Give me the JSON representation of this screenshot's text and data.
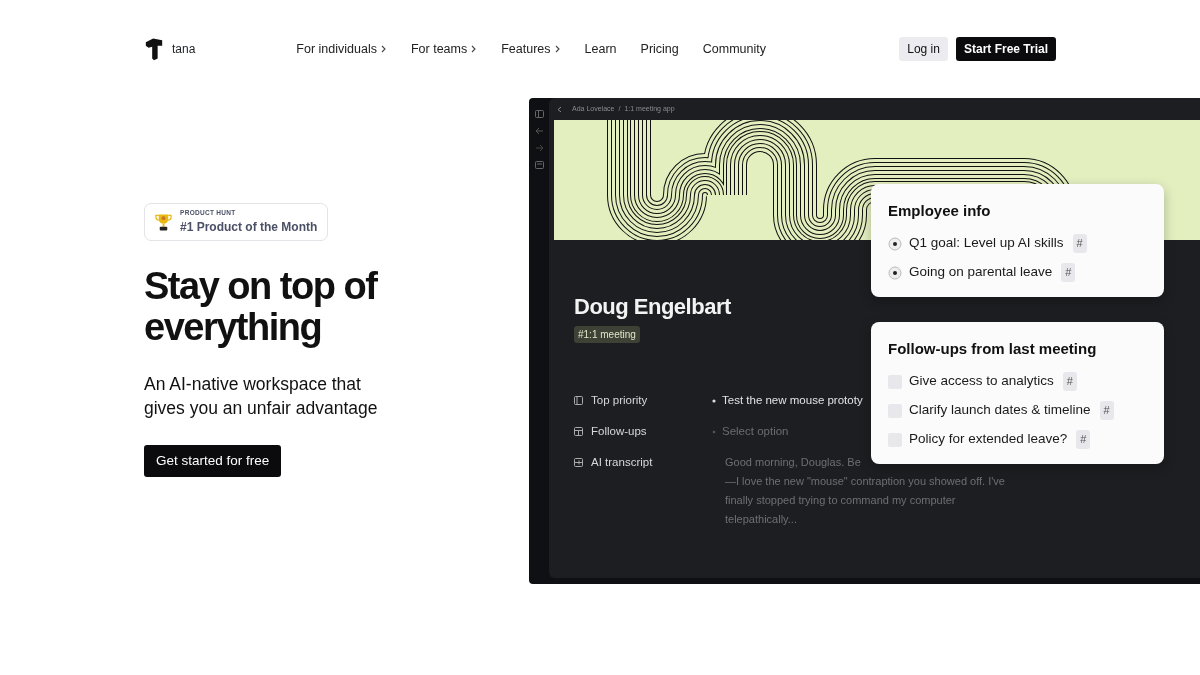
{
  "brand": {
    "name": "tana"
  },
  "nav": [
    {
      "label": "For individuals",
      "has_menu": true
    },
    {
      "label": "For teams",
      "has_menu": true
    },
    {
      "label": "Features",
      "has_menu": true
    },
    {
      "label": "Learn",
      "has_menu": false
    },
    {
      "label": "Pricing",
      "has_menu": false
    },
    {
      "label": "Community",
      "has_menu": false
    }
  ],
  "actions": [
    {
      "label": "Log in",
      "kind": "secondary"
    },
    {
      "label": "Start Free Trial",
      "kind": "primary"
    }
  ],
  "hero": {
    "award": {
      "source": "PRODUCT HUNT",
      "title": "#1 Product of the Month"
    },
    "title": "Stay on top of everything",
    "subtitle": "An AI-native workspace that gives you an unfair advantage",
    "cta": "Get started for free"
  },
  "app": {
    "breadcrumb": [
      "Ada Lovelace",
      "/",
      "1:1 meeting app"
    ],
    "page_title": "Doug Engelbart",
    "tag": "#1:1 meeting",
    "fields": [
      {
        "label": "Top priority",
        "kind": "value",
        "value": "Test the new mouse prototy"
      },
      {
        "label": "Follow-ups",
        "kind": "placeholder",
        "value": "Select option"
      },
      {
        "label": "AI transcript",
        "kind": "paragraph",
        "lines": [
          "Good morning, Douglas. Be",
          "—I love the new \"mouse\" contraption you showed off. I've",
          "finally stopped trying to command my computer",
          "telepathically..."
        ]
      }
    ],
    "cards": [
      {
        "title": "Employee info",
        "items": [
          {
            "kind": "bullet",
            "text": "Q1 goal: Level up AI skills",
            "tag": "#"
          },
          {
            "kind": "bullet",
            "text": "Going on parental leave",
            "tag": "#"
          }
        ]
      },
      {
        "title": "Follow-ups from last meeting",
        "items": [
          {
            "kind": "checkbox",
            "checked": false,
            "text": "Give access to analytics",
            "tag": "#"
          },
          {
            "kind": "checkbox",
            "checked": false,
            "text": "Clarify launch dates & timeline",
            "tag": "#"
          },
          {
            "kind": "checkbox",
            "checked": false,
            "text": "Policy for extended leave?",
            "tag": "#"
          }
        ]
      }
    ]
  }
}
